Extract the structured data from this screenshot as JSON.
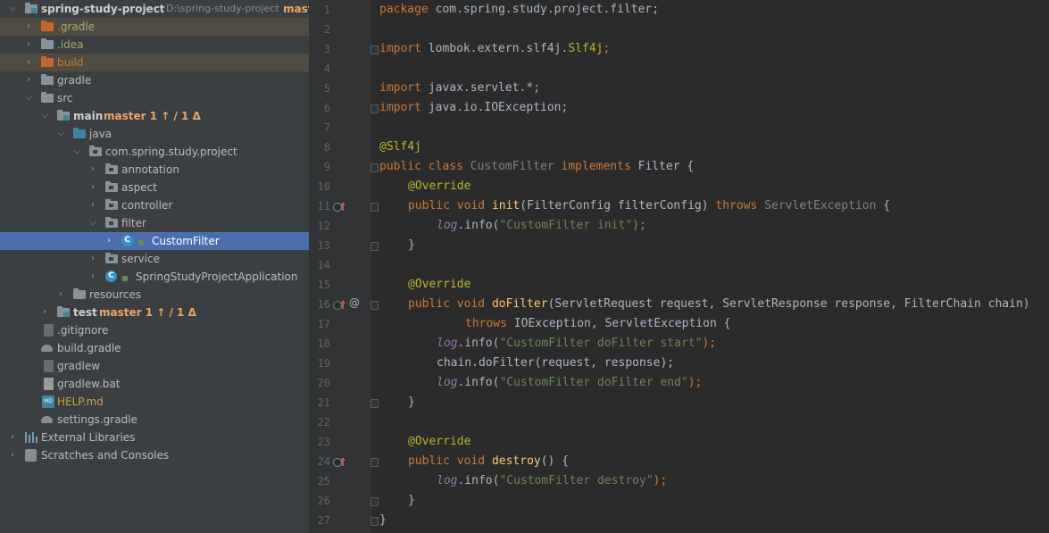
{
  "project_tree": {
    "rows": [
      {
        "label": "spring-study-project",
        "path": "D:\\spring-study-project",
        "branch": "mast"
      },
      {
        "label": ".gradle"
      },
      {
        "label": ".idea"
      },
      {
        "label": "build"
      },
      {
        "label": "gradle"
      },
      {
        "label": "src"
      },
      {
        "label": "main",
        "branch": "master 1 ↑ / 1 Δ"
      },
      {
        "label": "java"
      },
      {
        "label": "com.spring.study.project"
      },
      {
        "label": "annotation"
      },
      {
        "label": "aspect"
      },
      {
        "label": "controller"
      },
      {
        "label": "filter"
      },
      {
        "label": "CustomFilter"
      },
      {
        "label": "service"
      },
      {
        "label": "SpringStudyProjectApplication"
      },
      {
        "label": "resources"
      },
      {
        "label": "test",
        "branch": "master 1 ↑ / 1 Δ"
      },
      {
        "label": ".gitignore"
      },
      {
        "label": "build.gradle"
      },
      {
        "label": "gradlew"
      },
      {
        "label": "gradlew.bat"
      },
      {
        "label": "HELP.md"
      },
      {
        "label": "settings.gradle"
      },
      {
        "label": "External Libraries"
      },
      {
        "label": "Scratches and Consoles"
      }
    ]
  },
  "editor": {
    "line_numbers": [
      "1",
      "2",
      "3",
      "4",
      "5",
      "6",
      "7",
      "8",
      "9",
      "10",
      "11",
      "12",
      "13",
      "14",
      "15",
      "16",
      "17",
      "18",
      "19",
      "20",
      "21",
      "22",
      "23",
      "24",
      "25",
      "26",
      "27"
    ],
    "code": {
      "l1": {
        "kw": "package",
        "rest": " com.spring.study.project.filter;"
      },
      "l3": {
        "kw": "import",
        "rest": " lombok.extern.slf4j.",
        "cls": "Slf4j",
        "end": ";"
      },
      "l5": {
        "kw": "import",
        "rest": " javax.servlet.*;"
      },
      "l6": {
        "kw": "import",
        "rest": " java.io.IOException;"
      },
      "l8": {
        "an": "@Slf4j"
      },
      "l9": {
        "kw1": "public",
        "kw2": "class",
        "name": "CustomFilter",
        "kw3": "implements",
        "iface": "Filter",
        "end": " {"
      },
      "l10": {
        "an": "@Override"
      },
      "l11": {
        "kw1": "public",
        "kw2": "void",
        "fn": "init",
        "params": "(FilterConfig filterConfig) ",
        "kw3": "throws",
        "exc": "ServletException",
        "end": " {"
      },
      "l12": {
        "log": "log",
        "mid": ".info(",
        "str": "\"CustomFilter init\"",
        "end": ");"
      },
      "l13": {
        "text": "}"
      },
      "l15": {
        "an": "@Override"
      },
      "l16": {
        "kw1": "public",
        "kw2": "void",
        "fn": "doFilter",
        "params": "(ServletRequest request, ServletResponse response, FilterChain chain)"
      },
      "l17": {
        "kw": "throws",
        "rest": " IOException, ServletException {"
      },
      "l18": {
        "log": "log",
        "mid": ".info(",
        "str": "\"CustomFilter doFilter start\"",
        "end": ");"
      },
      "l19": {
        "text": "chain.doFilter(request, response);"
      },
      "l20": {
        "log": "log",
        "mid": ".info(",
        "str": "\"CustomFilter doFilter end\"",
        "end": ");"
      },
      "l21": {
        "text": "}"
      },
      "l23": {
        "an": "@Override"
      },
      "l24": {
        "kw1": "public",
        "kw2": "void",
        "fn": "destroy",
        "end": "() {"
      },
      "l25": {
        "log": "log",
        "mid": ".info(",
        "str": "\"CustomFilter destroy\"",
        "end": ");"
      },
      "l26": {
        "text": "}"
      },
      "l27": {
        "text": "}"
      }
    },
    "gutter_at": "@"
  },
  "colors": {
    "keyword": "#cc7832",
    "annotation": "#bbb529",
    "function": "#ffc66d",
    "string": "#6a8759",
    "field": "#9876aa",
    "selection": "#4b6eaf"
  }
}
